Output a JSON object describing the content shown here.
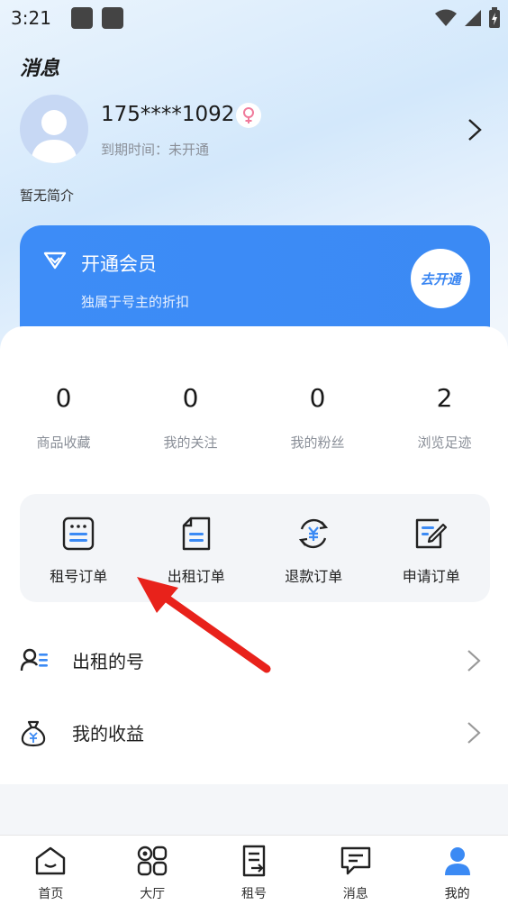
{
  "status_bar": {
    "time": "3:21"
  },
  "header": {
    "title": "消息"
  },
  "profile": {
    "username": "175****1092",
    "expire_label": "到期时间：未开通",
    "bio": "暂无简介"
  },
  "vip": {
    "title": "开通会员",
    "subtitle": "独属于号主的折扣",
    "button": "去开通",
    "accent": "#3B8AF4"
  },
  "stats": [
    {
      "value": "0",
      "label": "商品收藏"
    },
    {
      "value": "0",
      "label": "我的关注"
    },
    {
      "value": "0",
      "label": "我的粉丝"
    },
    {
      "value": "2",
      "label": "浏览足迹"
    }
  ],
  "orders": [
    {
      "label": "租号订单",
      "icon": "rent-order-icon"
    },
    {
      "label": "出租订单",
      "icon": "lease-order-icon"
    },
    {
      "label": "退款订单",
      "icon": "refund-order-icon"
    },
    {
      "label": "申请订单",
      "icon": "apply-order-icon"
    }
  ],
  "list": [
    {
      "label": "出租的号",
      "icon": "user-list-icon"
    },
    {
      "label": "我的收益",
      "icon": "money-bag-icon"
    }
  ],
  "nav": [
    {
      "label": "首页",
      "icon": "home-icon"
    },
    {
      "label": "大厅",
      "icon": "hall-icon"
    },
    {
      "label": "租号",
      "icon": "rent-icon"
    },
    {
      "label": "消息",
      "icon": "message-icon"
    },
    {
      "label": "我的",
      "icon": "profile-icon",
      "active": true
    }
  ],
  "colors": {
    "annotation_arrow": "#E8221B",
    "active_nav": "#3B8AF4"
  }
}
